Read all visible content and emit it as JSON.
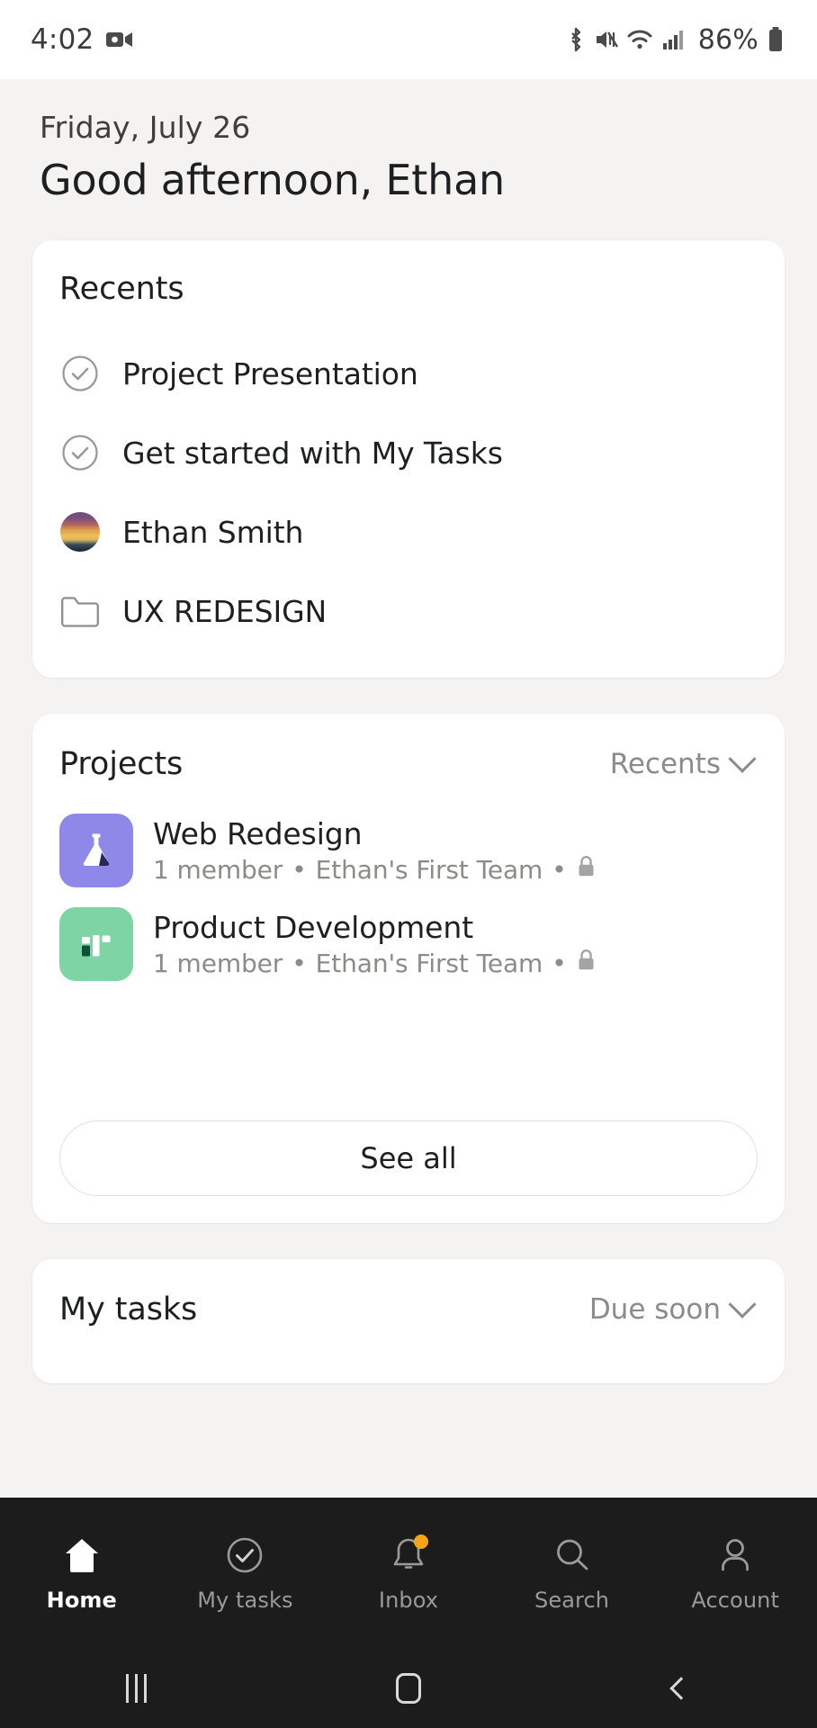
{
  "status_bar": {
    "time": "4:02",
    "battery_percent": "86%",
    "icons": [
      "screen-record-icon",
      "bluetooth-icon",
      "mute-icon",
      "wifi-icon",
      "signal-icon",
      "battery-icon"
    ]
  },
  "header": {
    "date": "Friday, July 26",
    "greeting": "Good afternoon, Ethan"
  },
  "recents_card": {
    "title": "Recents",
    "items": [
      {
        "label": "Project Presentation",
        "icon": "check-circle-icon"
      },
      {
        "label": "Get started with My Tasks",
        "icon": "check-circle-icon"
      },
      {
        "label": "Ethan Smith",
        "icon": "avatar-icon"
      },
      {
        "label": "UX REDESIGN",
        "icon": "folder-icon"
      }
    ]
  },
  "projects_card": {
    "title": "Projects",
    "sort_label": "Recents",
    "sort_icon": "chevron-down-icon",
    "items": [
      {
        "name": "Web Redesign",
        "members": "1 member",
        "team": "Ethan's First Team",
        "privacy_icon": "lock-icon",
        "icon": "flask-icon",
        "color": "#8e89e8",
        "separator": "•"
      },
      {
        "name": "Product Development",
        "members": "1 member",
        "team": "Ethan's First Team",
        "privacy_icon": "lock-icon",
        "icon": "board-icon",
        "color": "#7fd4a6",
        "separator": "•"
      }
    ],
    "see_all_label": "See all"
  },
  "my_tasks_card": {
    "title": "My tasks",
    "sort_label": "Due soon",
    "sort_icon": "chevron-down-icon"
  },
  "bottom_nav": {
    "items": [
      {
        "label": "Home",
        "icon": "home-icon",
        "active": true,
        "badge": false
      },
      {
        "label": "My tasks",
        "icon": "check-circle-icon",
        "active": false,
        "badge": false
      },
      {
        "label": "Inbox",
        "icon": "bell-icon",
        "active": false,
        "badge": true
      },
      {
        "label": "Search",
        "icon": "search-icon",
        "active": false,
        "badge": false
      },
      {
        "label": "Account",
        "icon": "person-icon",
        "active": false,
        "badge": false
      }
    ],
    "badge_color": "#f2a517"
  },
  "system_nav": {
    "recents_icon": "recents-bars-icon",
    "home_icon": "home-square-icon",
    "back_icon": "back-chevron-icon"
  },
  "colors": {
    "page_background": "#f4f3f2",
    "card_background": "#ffffff",
    "primary_text": "#1e1f21",
    "secondary_text": "#8c8b89",
    "nav_background": "#1c1c1c"
  }
}
